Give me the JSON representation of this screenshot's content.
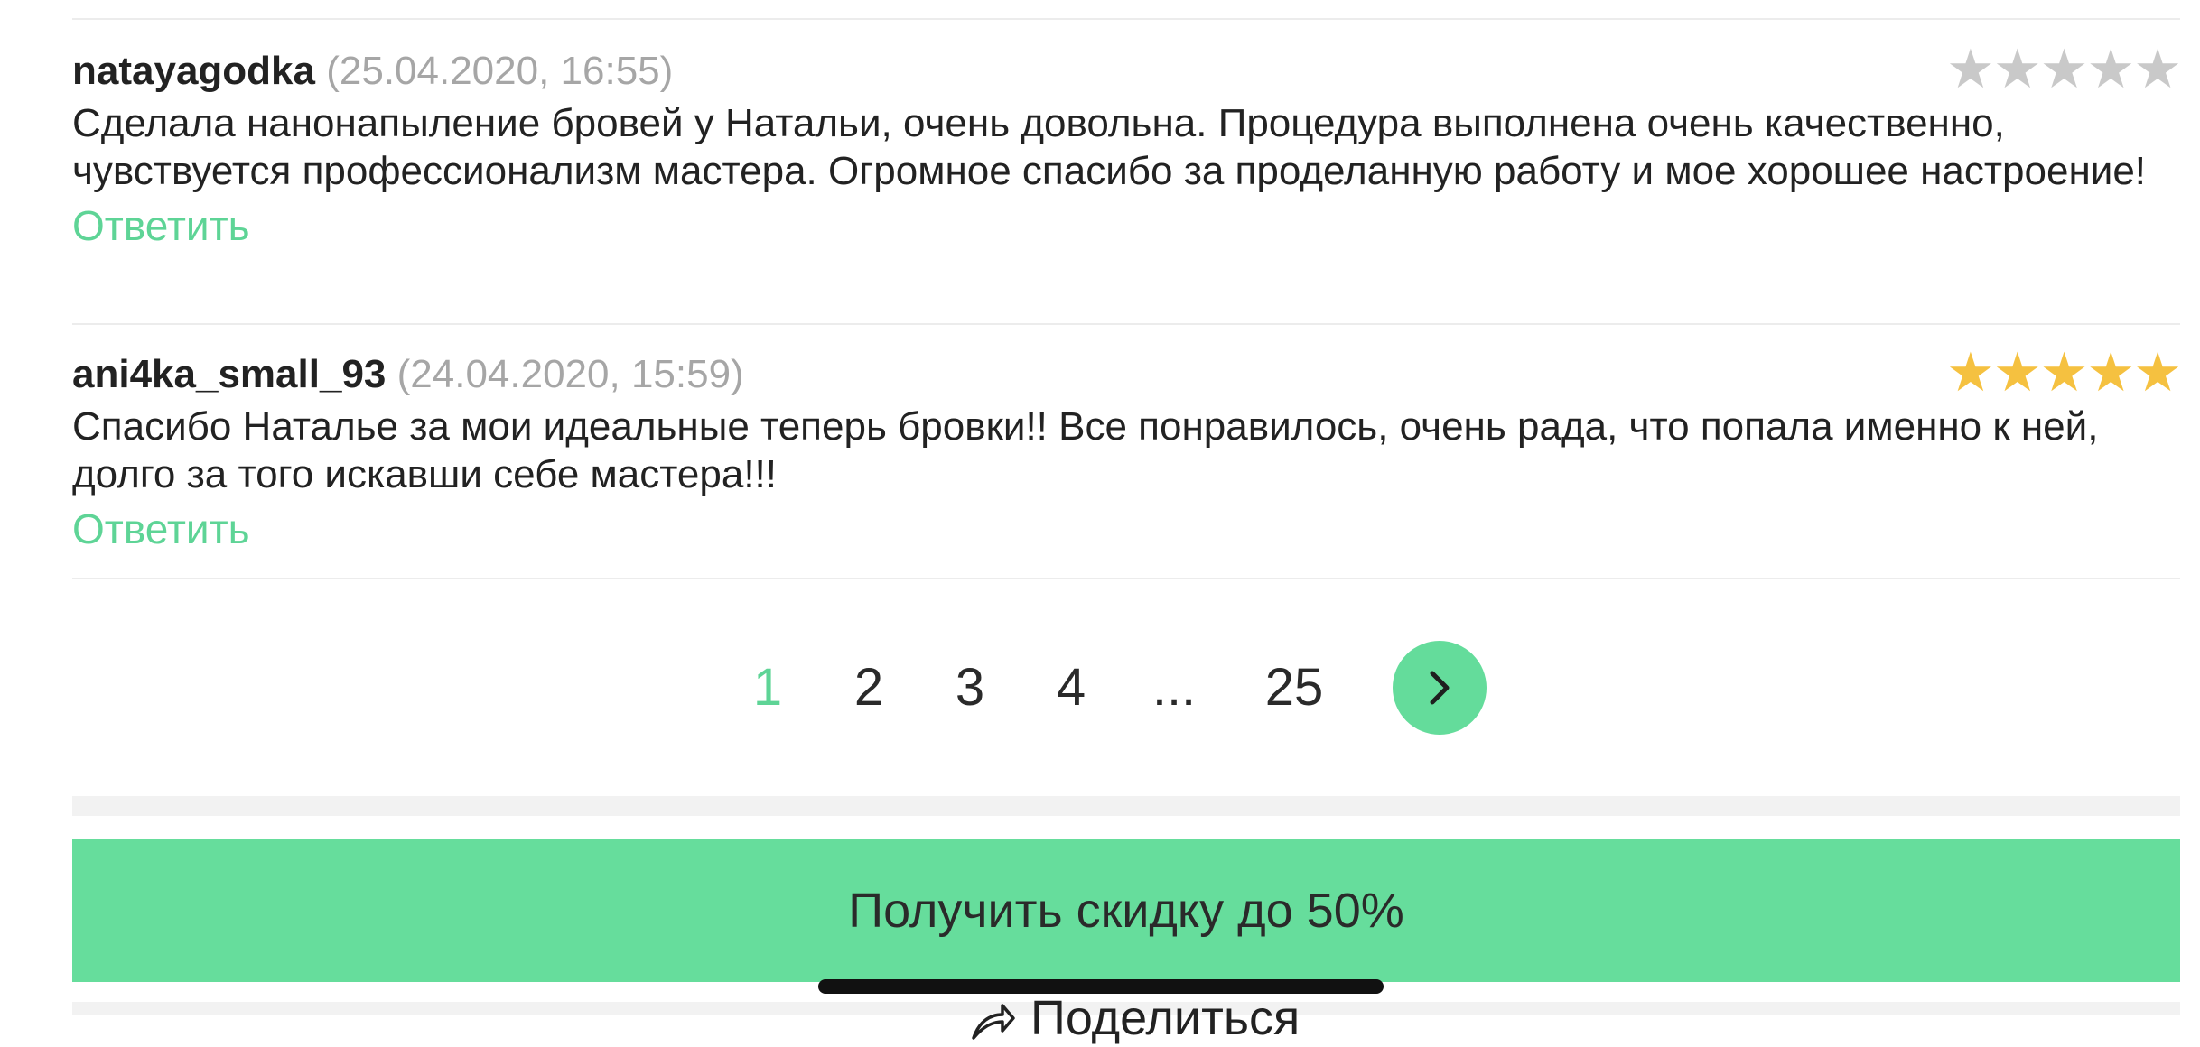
{
  "reviews": [
    {
      "author": "natayagodka",
      "date": "(25.04.2020, 16:55)",
      "rating": 0,
      "text": "Сделала нанонапыление бровей у Натальи, очень довольна. Процедура выполнена очень качественно, чувствуется профессионализм мастера. Огромное спасибо за проделанную работу и мое  хорошее настроение!",
      "reply_label": "Ответить"
    },
    {
      "author": "ani4ka_small_93",
      "date": "(24.04.2020, 15:59)",
      "rating": 5,
      "text": "Спасибо Наталье за мои идеальные теперь бровки!! Все понравилось, очень рада, что попала именно к ней, долго за того искавши себе мастера!!!",
      "reply_label": "Ответить"
    }
  ],
  "pagination": {
    "pages": [
      "1",
      "2",
      "3",
      "4",
      "...",
      "25"
    ],
    "current": "1",
    "next_icon": "chevron-right-icon"
  },
  "cta": {
    "label": "Получить скидку до 50%"
  },
  "share": {
    "label": "Поделиться",
    "icon": "share-icon"
  },
  "colors": {
    "accent": "#64dc9b",
    "link": "#5ed496",
    "star_filled": "#f5c140",
    "star_empty": "#c9c9c9",
    "muted": "#a6a6a6"
  }
}
